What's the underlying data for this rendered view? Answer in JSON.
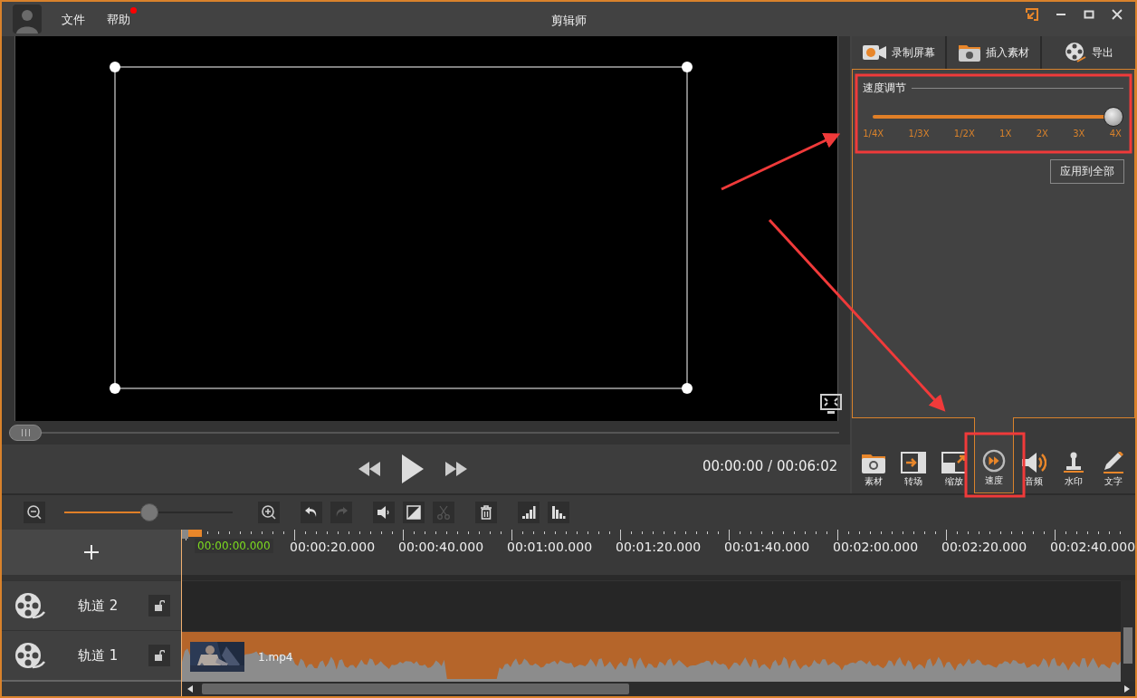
{
  "window": {
    "title": "剪辑师"
  },
  "menu": [
    {
      "label": "文件",
      "badge": false
    },
    {
      "label": "帮助",
      "badge": true
    }
  ],
  "player": {
    "time": "00:00:00 / 00:06:02"
  },
  "actions": [
    {
      "label": "录制屏幕"
    },
    {
      "label": "插入素材"
    },
    {
      "label": "导出"
    }
  ],
  "speed": {
    "title": "速度调节",
    "level": 1,
    "marks": [
      "1/4X",
      "1/3X",
      "1/2X",
      "1X",
      "2X",
      "3X",
      "4X"
    ],
    "apply": "应用到全部"
  },
  "tool_tabs": [
    {
      "label": "素材",
      "selected": false
    },
    {
      "label": "转场",
      "selected": false
    },
    {
      "label": "缩放",
      "selected": false
    },
    {
      "label": "速度",
      "selected": true
    },
    {
      "label": "音频",
      "selected": false
    },
    {
      "label": "水印",
      "selected": false
    },
    {
      "label": "文字",
      "selected": false
    }
  ],
  "toolbar": {
    "zoom": {
      "level": 0.5
    },
    "buttons": [
      {
        "disabled": false
      },
      {
        "disabled": true
      },
      {
        "disabled": false
      },
      {
        "disabled": false
      },
      {
        "disabled": true
      },
      {
        "disabled": false
      },
      {
        "disabled": false
      },
      {
        "disabled": false
      }
    ]
  },
  "timeline": {
    "current": "00:00:00.000",
    "ticks": [
      "00:00:20.000",
      "00:00:40.000",
      "00:01:00.000",
      "00:01:20.000",
      "00:01:40.000",
      "00:02:00.000",
      "00:02:20.000",
      "00:02:40.000"
    ]
  },
  "tracks": [
    {
      "name": "轨道 2"
    },
    {
      "name": "轨道 1",
      "clip": {
        "label": "1.mp4"
      }
    }
  ]
}
